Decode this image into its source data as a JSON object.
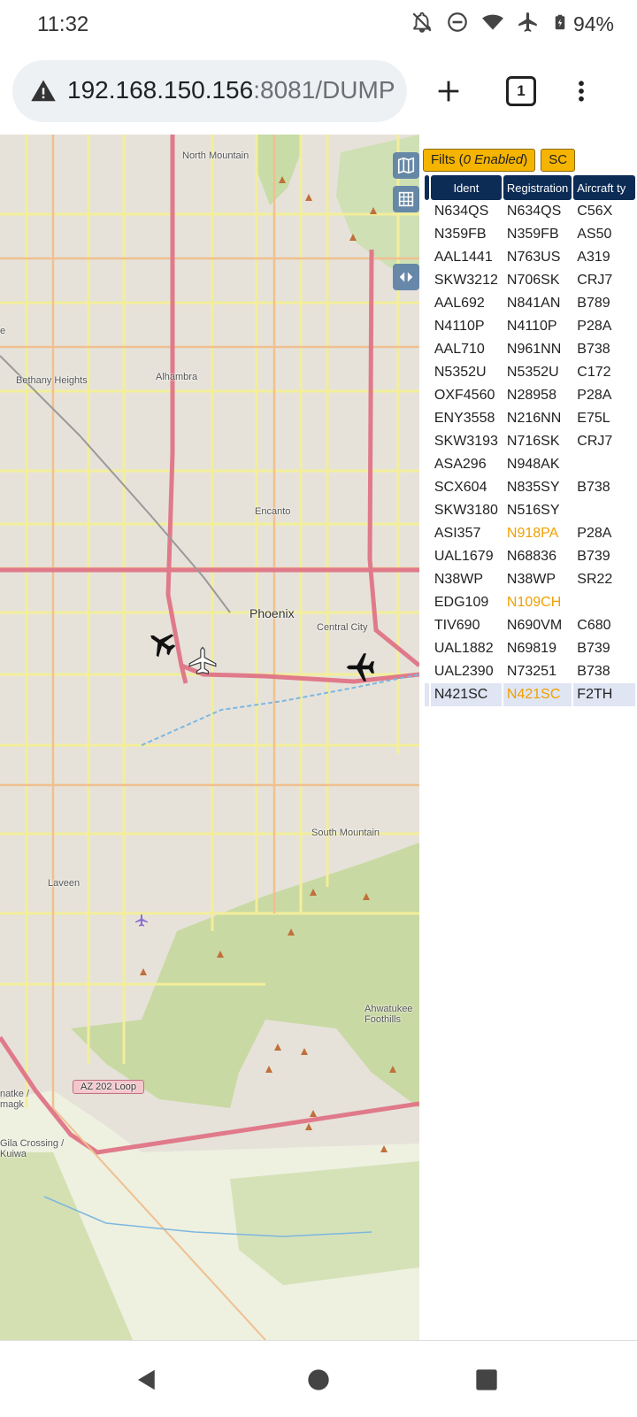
{
  "status_bar": {
    "time": "11:32",
    "battery": "94%",
    "icons": [
      "bell-off-icon",
      "do-not-disturb-icon",
      "wifi-icon",
      "airplane-mode-icon",
      "battery-icon"
    ]
  },
  "browser": {
    "url_host": "192.168.150.156",
    "url_rest": ":8081/DUMP",
    "tab_count": "1"
  },
  "map": {
    "labels": {
      "north_mountain": "North Mountain",
      "bethany_heights": "Bethany Heights",
      "alhambra": "Alhambra",
      "encanto": "Encanto",
      "phoenix": "Phoenix",
      "central_city": "Central City",
      "south_mountain": "South Mountain",
      "laveen": "Laveen",
      "ahwatukee": "Ahwatukee Foothills",
      "az202": "AZ 202 Loop",
      "natke": "natke / magk",
      "gila": "Gila Crossing / Kuiwa",
      "e_edge": "e"
    }
  },
  "panel": {
    "filters_label": "Filts (",
    "filters_enabled": "0 Enabled",
    "filters_close": ")",
    "sc_label": "SC",
    "columns": [
      "Ident",
      "Registration",
      "Aircraft ty"
    ],
    "rows": [
      {
        "ident": "N634QS",
        "reg": "N634QS",
        "type": "C56X"
      },
      {
        "ident": "N359FB",
        "reg": "N359FB",
        "type": "AS50"
      },
      {
        "ident": "AAL1441",
        "reg": "N763US",
        "type": "A319"
      },
      {
        "ident": "SKW3212",
        "reg": "N706SK",
        "type": "CRJ7"
      },
      {
        "ident": "AAL692",
        "reg": "N841AN",
        "type": "B789"
      },
      {
        "ident": "N4110P",
        "reg": "N4110P",
        "type": "P28A"
      },
      {
        "ident": "AAL710",
        "reg": "N961NN",
        "type": "B738"
      },
      {
        "ident": "N5352U",
        "reg": "N5352U",
        "type": "C172"
      },
      {
        "ident": "OXF4560",
        "reg": "N28958",
        "type": "P28A"
      },
      {
        "ident": "ENY3558",
        "reg": "N216NN",
        "type": "E75L"
      },
      {
        "ident": "SKW3193",
        "reg": "N716SK",
        "type": "CRJ7"
      },
      {
        "ident": "ASA296",
        "reg": "N948AK",
        "type": ""
      },
      {
        "ident": "SCX604",
        "reg": "N835SY",
        "type": "B738"
      },
      {
        "ident": "SKW3180",
        "reg": "N516SY",
        "type": ""
      },
      {
        "ident": "ASI357",
        "reg": "N918PA",
        "type": "P28A"
      },
      {
        "ident": "UAL1679",
        "reg": "N68836",
        "type": "B739"
      },
      {
        "ident": "N38WP",
        "reg": "N38WP",
        "type": "SR22"
      },
      {
        "ident": "EDG109",
        "reg": "N109CH",
        "type": ""
      },
      {
        "ident": "TIV690",
        "reg": "N690VM",
        "type": "C680"
      },
      {
        "ident": "UAL1882",
        "reg": "N69819",
        "type": "B739"
      },
      {
        "ident": "UAL2390",
        "reg": "N73251",
        "type": "B738"
      },
      {
        "ident": "N421SC",
        "reg": "N421SC",
        "type": "F2TH"
      }
    ],
    "orange_color": "#f0a000",
    "header_color": "#0d2c55",
    "button_color": "#f5b400"
  }
}
